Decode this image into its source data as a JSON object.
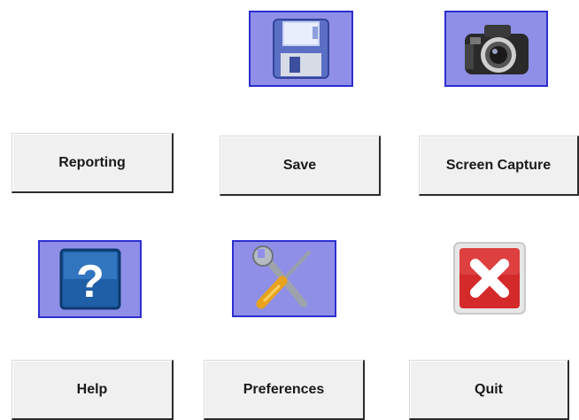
{
  "buttons": {
    "reporting": "Reporting",
    "save": "Save",
    "screen_capture": "Screen Capture",
    "help": "Help",
    "preferences": "Preferences",
    "quit": "Quit"
  },
  "icons": {
    "save": "floppy-disk-icon",
    "screen_capture": "camera-icon",
    "help": "help-question-icon",
    "preferences": "wrench-screwdriver-icon",
    "quit": "close-x-icon"
  },
  "colors": {
    "icon_tile_bg": "#8f8fe8",
    "icon_tile_border": "#2e2ed0",
    "button_bg": "#f0f0f0",
    "quit_red": "#d42a2a"
  }
}
